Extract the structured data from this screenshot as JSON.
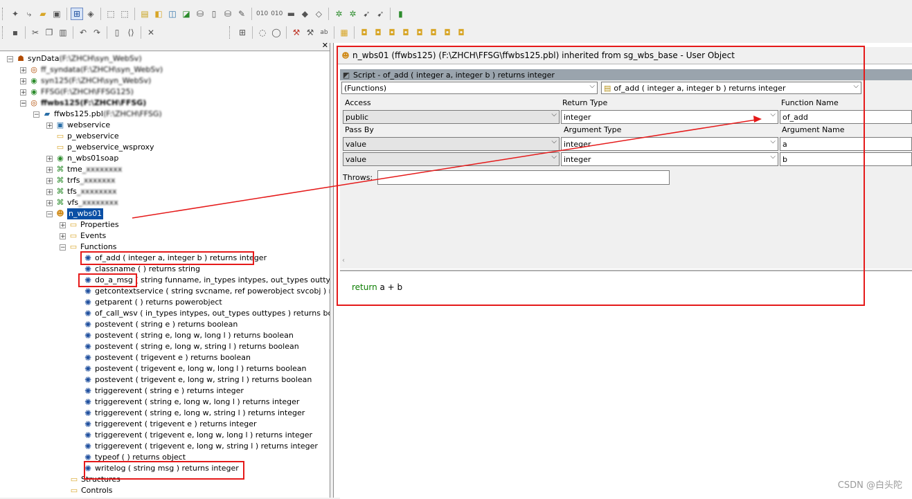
{
  "toolbar1": {
    "icons": [
      "new-icon",
      "inherit-icon",
      "open-icon",
      "library-painter-icon",
      "select-icon",
      "library-list-icon",
      "build-icon",
      "deploy-icon",
      "script-icon",
      "object-icon",
      "project-icon",
      "query-icon",
      "database-icon",
      "database-profile-icon",
      "edit-icon",
      "binary-010-icon",
      "binary-01-icon",
      "vehicle-icon",
      "cube-icon",
      "package-icon",
      "bug-icon",
      "debug-icon",
      "run-icon",
      "stop-icon",
      "exit-icon"
    ]
  },
  "toolbar2": {
    "icons": [
      "save-icon",
      "cut-icon",
      "copy-icon",
      "paste-icon",
      "undo-icon",
      "redo-icon",
      "comment-icon",
      "indent-icon",
      "close-icon",
      "grid-icon",
      "speech-icon",
      "bubble-icon",
      "wand-icon",
      "tool-icon",
      "replace-icon",
      "grid2-icon",
      "layer1-icon",
      "layer2-icon",
      "layer3-icon",
      "layer4-icon",
      "layer5-icon",
      "layer6-icon",
      "layer7-icon"
    ]
  },
  "tree": {
    "items": [
      {
        "label": "synData",
        "blurred": " (F:\\ZHCH\\syn_WebSv)"
      },
      {
        "label": "ff_syndata",
        "blurred": " (F:\\ZHCH\\syn_WebSv)"
      },
      {
        "label": "syn125",
        "blurred": " (F:\\ZHCH\\syn_WebSv)"
      },
      {
        "label": "FFSG",
        "blurred": " (F:\\ZHCH\\FFSG125)"
      },
      {
        "label": "ffwbs125",
        "blurred": " (F:\\ZHCH\\FFSG)"
      },
      {
        "label": "ffwbs125.pbl",
        "blurred": " (F:\\ZHCH\\FFSG)"
      },
      {
        "label": "webservice"
      },
      {
        "label": "p_webservice"
      },
      {
        "label": "p_webservice_wsproxy"
      },
      {
        "label": "n_wbs01soap"
      },
      {
        "label": "tme",
        "blurred": "_xxxxxxxx"
      },
      {
        "label": "trfs",
        "blurred": "_xxxxxxx"
      },
      {
        "label": "tfs",
        "blurred": "_xxxxxxxx"
      },
      {
        "label": "vfs",
        "blurred": "_xxxxxxxx"
      },
      {
        "label": "n_wbs01"
      },
      {
        "label": "Properties"
      },
      {
        "label": "Events"
      },
      {
        "label": "Functions"
      },
      {
        "label": "of_add ( integer a, integer b )  returns integer"
      },
      {
        "label": "classname ( )  returns string"
      },
      {
        "label": "do_a_msg ( string funname, in_types intypes, out_types outtypes )"
      },
      {
        "label": "getcontextservice ( string svcname, ref powerobject svcobj )  return"
      },
      {
        "label": "getparent ( )  returns powerobject"
      },
      {
        "label": "of_call_wsv ( in_types intypes, out_types outtypes )  returns boolea"
      },
      {
        "label": "postevent ( string e )  returns boolean"
      },
      {
        "label": "postevent ( string e, long w, long l )  returns boolean"
      },
      {
        "label": "postevent ( string e, long w, string l )  returns boolean"
      },
      {
        "label": "postevent ( trigevent e )  returns boolean"
      },
      {
        "label": "postevent ( trigevent e, long w, long l )  returns boolean"
      },
      {
        "label": "postevent ( trigevent e, long w, string l )  returns boolean"
      },
      {
        "label": "triggerevent ( string e )  returns integer"
      },
      {
        "label": "triggerevent ( string e, long w, long l )  returns integer"
      },
      {
        "label": "triggerevent ( string e, long w, string l )  returns integer"
      },
      {
        "label": "triggerevent ( trigevent e )  returns integer"
      },
      {
        "label": "triggerevent ( trigevent e, long w, long l )  returns integer"
      },
      {
        "label": "triggerevent ( trigevent e, long w, string l )  returns integer"
      },
      {
        "label": "typeof ( )  returns object"
      },
      {
        "label": "writelog ( string msg )  returns integer"
      },
      {
        "label": "Structures"
      },
      {
        "label": "Controls"
      }
    ]
  },
  "editor": {
    "title": "n_wbs01 (ffwbs125) (F:\\ZHCH\\FFSG\\ffwbs125.pbl) inherited from sg_wbs_base - User Object",
    "script_title": "Script - of_add ( integer a, integer b )  returns integer",
    "category_dropdown": "(Functions)",
    "function_dropdown": "of_add ( integer a, integer b )  returns integer",
    "labels": {
      "access": "Access",
      "return_type": "Return Type",
      "function_name": "Function Name",
      "pass_by": "Pass By",
      "argument_type": "Argument Type",
      "argument_name": "Argument Name",
      "throws": "Throws:"
    },
    "access": "public",
    "return_type": "integer",
    "function_name": "of_add",
    "arguments": [
      {
        "pass_by": "value",
        "type": "integer",
        "name": "a"
      },
      {
        "pass_by": "value",
        "type": "integer",
        "name": "b"
      }
    ],
    "throws": "",
    "code_keyword": "return",
    "code_rest": " a + b"
  },
  "watermark": "CSDN @白头陀",
  "colors": {
    "annotation": "#e51919",
    "selection": "#0a4fa5",
    "keyword": "#0b7d00"
  }
}
